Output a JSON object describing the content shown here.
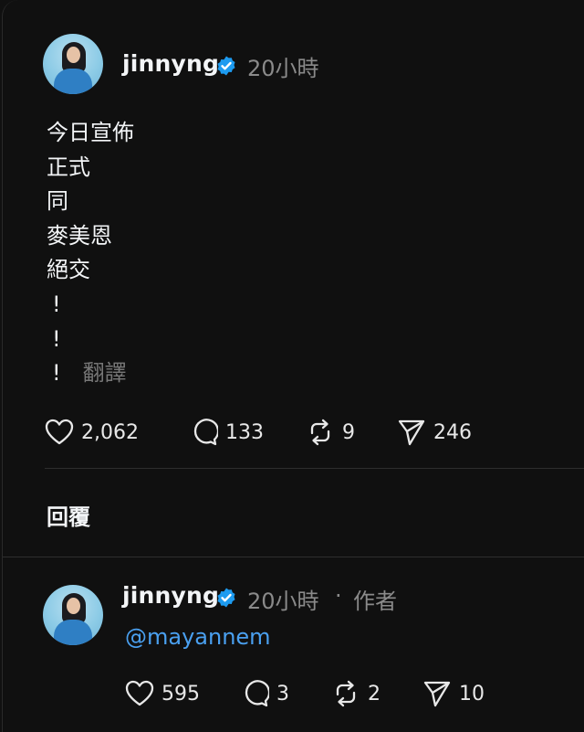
{
  "post": {
    "username": "jinnyng",
    "time": "20小時",
    "lines": [
      "今日宣佈",
      "正式",
      "同",
      "麥美恩",
      "絕交",
      "!",
      "!",
      "!"
    ],
    "translate": "翻譯",
    "likes": "2,062",
    "comments": "133",
    "reposts": "9",
    "shares": "246"
  },
  "replies_tab": {
    "label": "回覆"
  },
  "reply": {
    "username": "jinnyng",
    "time": "20小時",
    "separator": "·",
    "author_tag": "作者",
    "mention": "@mayannem",
    "likes": "595",
    "comments": "3",
    "reposts": "2",
    "shares": "10"
  },
  "colors": {
    "background": "#101010",
    "text": "#f3f5f7",
    "muted": "#8a8a8a",
    "verified": "#1d9bf0",
    "link": "#4aa0f0"
  },
  "icons": {
    "like": "heart-icon",
    "comment": "comment-bubble-icon",
    "repost": "repost-icon",
    "share": "send-icon",
    "verified": "verified-badge-icon"
  }
}
